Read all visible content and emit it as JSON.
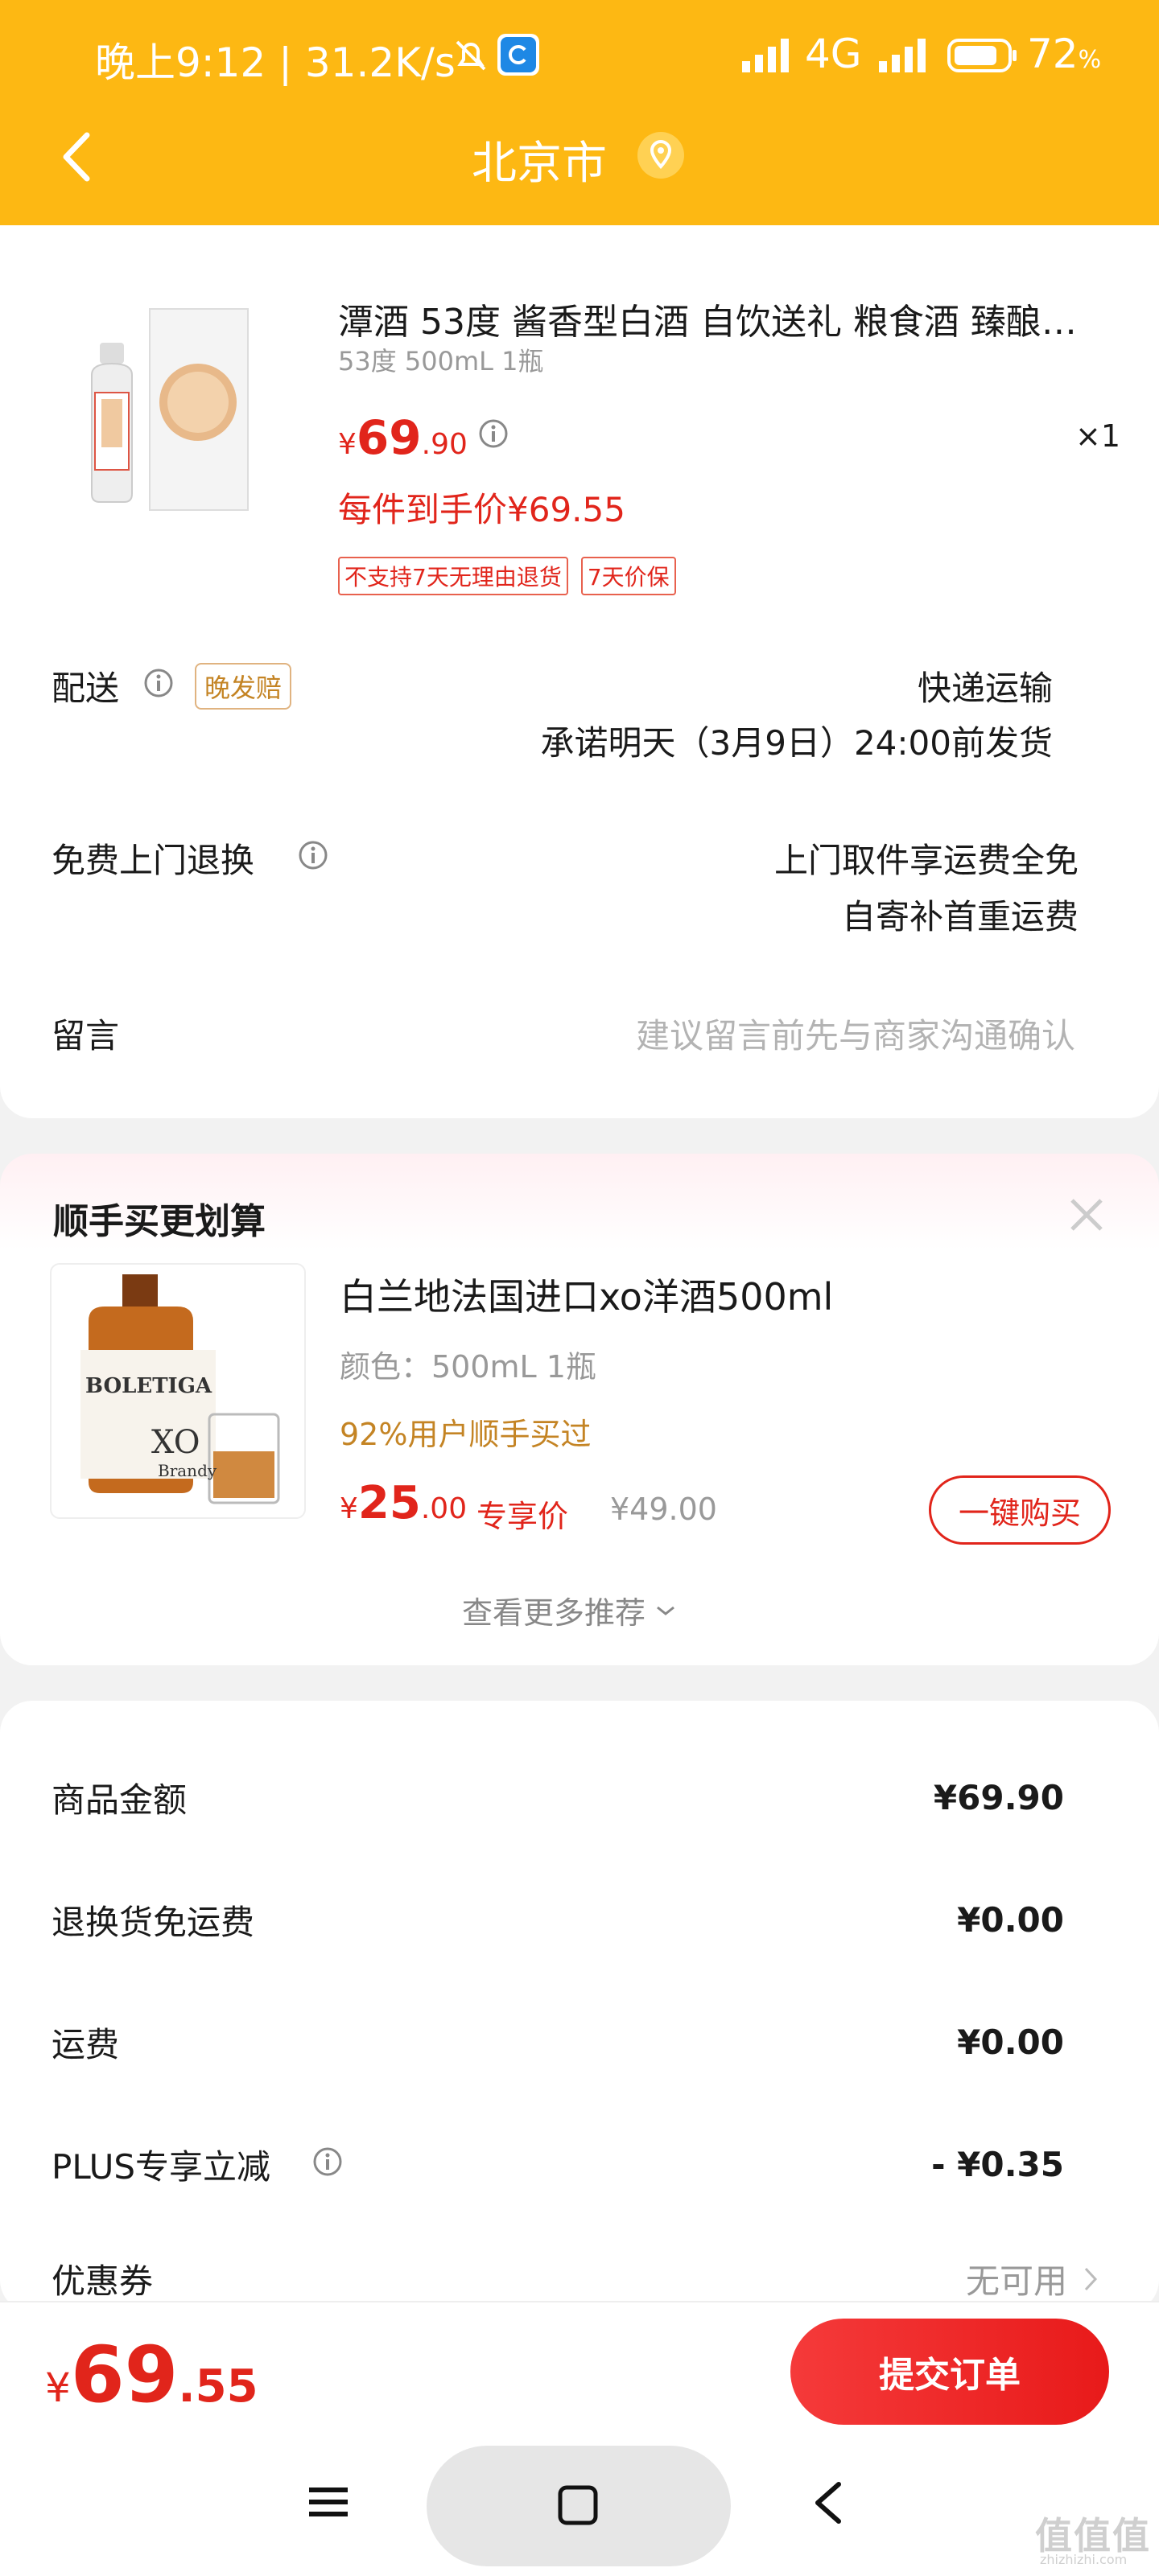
{
  "status_bar": {
    "left": "晚上9:12 | 31.2K/s",
    "network": "4G",
    "battery": "72",
    "battery_unit": "%"
  },
  "header": {
    "title": "北京市"
  },
  "product": {
    "name": "潭酒 53度 酱香型白酒 自饮送礼 粮食酒 臻酿…",
    "spec": "53度 500mL 1瓶",
    "price_symbol": "¥",
    "price_int": "69",
    "price_dec": ".90",
    "quantity": "×1",
    "final_price_label": "每件到手价¥69.55",
    "tags": [
      "不支持7天无理由退货",
      "7天价保"
    ]
  },
  "delivery": {
    "label": "配送",
    "badge": "晚发赔",
    "method": "快递运输",
    "promise": "承诺明天（3月9日）24:00前发货"
  },
  "return_service": {
    "label": "免费上门退换",
    "line1": "上门取件享运费全免",
    "line2": "自寄补首重运费"
  },
  "message": {
    "label": "留言",
    "placeholder": "建议留言前先与商家沟通确认"
  },
  "recommend": {
    "title": "顺手买更划算",
    "item": {
      "name": "白兰地法国进口xo洋酒500ml",
      "spec": "颜色：500mL 1瓶",
      "social": "92%用户顺手买过",
      "price_symbol": "¥",
      "price_int": "25",
      "price_dec": ".00",
      "price_tag": "专享价",
      "orig_price": "¥49.00",
      "buy_label": "一键购买",
      "image_labels": {
        "brand": "BOLETIGA",
        "grade": "XO",
        "type": "Brandy"
      }
    },
    "more": "查看更多推荐"
  },
  "summary": {
    "rows": [
      {
        "label": "商品金额",
        "value": "¥69.90"
      },
      {
        "label": "退换货免运费",
        "value": "¥0.00"
      },
      {
        "label": "运费",
        "value": "¥0.00"
      },
      {
        "label": "PLUS专享立减",
        "value": "- ¥0.35"
      }
    ],
    "coupon_label": "优惠券",
    "coupon_value": "无可用"
  },
  "footer": {
    "total_symbol": "¥",
    "total_int": "69",
    "total_dec": ".55",
    "submit_label": "提交订单"
  },
  "watermark": "值值值",
  "watermark_sub": "zhizhizhi.com",
  "colors": {
    "header": "#FDB813",
    "accent_red": "#E1251B",
    "gold": "#C48424"
  }
}
